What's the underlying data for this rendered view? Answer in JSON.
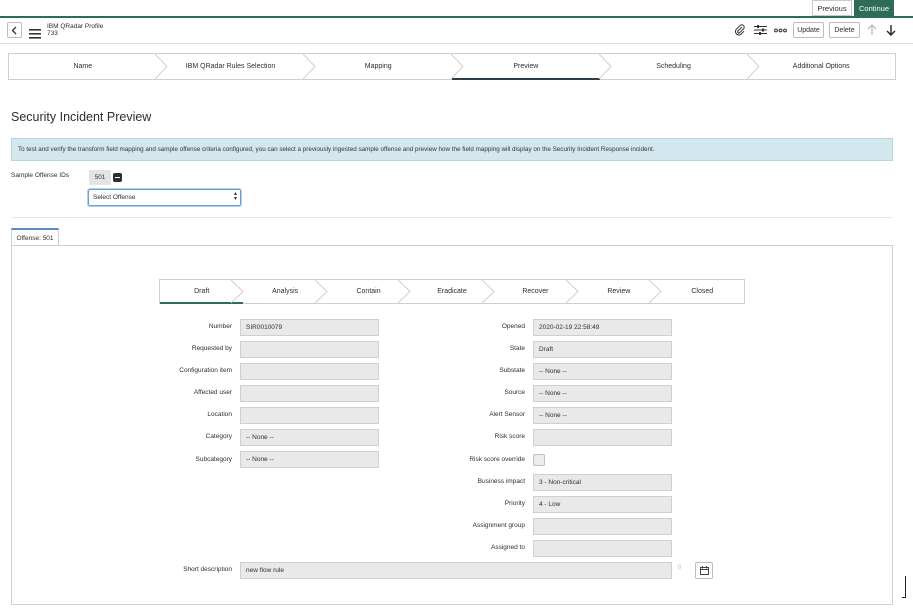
{
  "nav": {
    "previous": "Previous",
    "continue": "Continue"
  },
  "header": {
    "title": "IBM QRadar Profile",
    "subtitle": "733",
    "update": "Update",
    "delete": "Delete"
  },
  "wizard": {
    "steps": [
      "Name",
      "IBM QRadar Rules Selection",
      "Mapping",
      "Preview",
      "Scheduling",
      "Additional Options"
    ],
    "active": "Preview"
  },
  "page": {
    "title": "Security Incident Preview",
    "info": "To test and verify the transform field mapping and sample offense criteria configured, you can select a previously ingested sample offense and preview how the field mapping will display on the Security Incident Response incident.",
    "sample_label": "Sample Offense IDs",
    "sample_id": "501",
    "select_value": "Select Offense"
  },
  "tab": {
    "label": "Offense: 501"
  },
  "stages": {
    "steps": [
      "Draft",
      "Analysis",
      "Contain",
      "Eradicate",
      "Recover",
      "Review",
      "Closed"
    ],
    "active": "Draft"
  },
  "form": {
    "left": [
      {
        "label": "Number",
        "value": "SIR0010079"
      },
      {
        "label": "Requested by",
        "value": ""
      },
      {
        "label": "Configuration item",
        "value": ""
      },
      {
        "label": "Affected user",
        "value": ""
      },
      {
        "label": "Location",
        "value": ""
      },
      {
        "label": "Category",
        "value": "-- None --"
      },
      {
        "label": "Subcategory",
        "value": "-- None --"
      }
    ],
    "right": [
      {
        "label": "Opened",
        "value": "2020-02-19 22:58:49"
      },
      {
        "label": "State",
        "value": "Draft"
      },
      {
        "label": "Substate",
        "value": "-- None --"
      },
      {
        "label": "Source",
        "value": "-- None --"
      },
      {
        "label": "Alert Sensor",
        "value": "-- None --"
      },
      {
        "label": "Risk score",
        "value": ""
      },
      {
        "label": "Risk score override",
        "value": ""
      },
      {
        "label": "Business impact",
        "value": "3 - Non-critical"
      },
      {
        "label": "Priority",
        "value": "4 - Low"
      },
      {
        "label": "Assignment group",
        "value": ""
      },
      {
        "label": "Assigned to",
        "value": ""
      }
    ],
    "short_description": {
      "label": "Short description",
      "value": "new flow rule",
      "count": "0"
    }
  },
  "colors": {
    "accent": "#2e6b58",
    "info_bg": "#d3e8ee",
    "field_bg": "#e9e9e9"
  }
}
